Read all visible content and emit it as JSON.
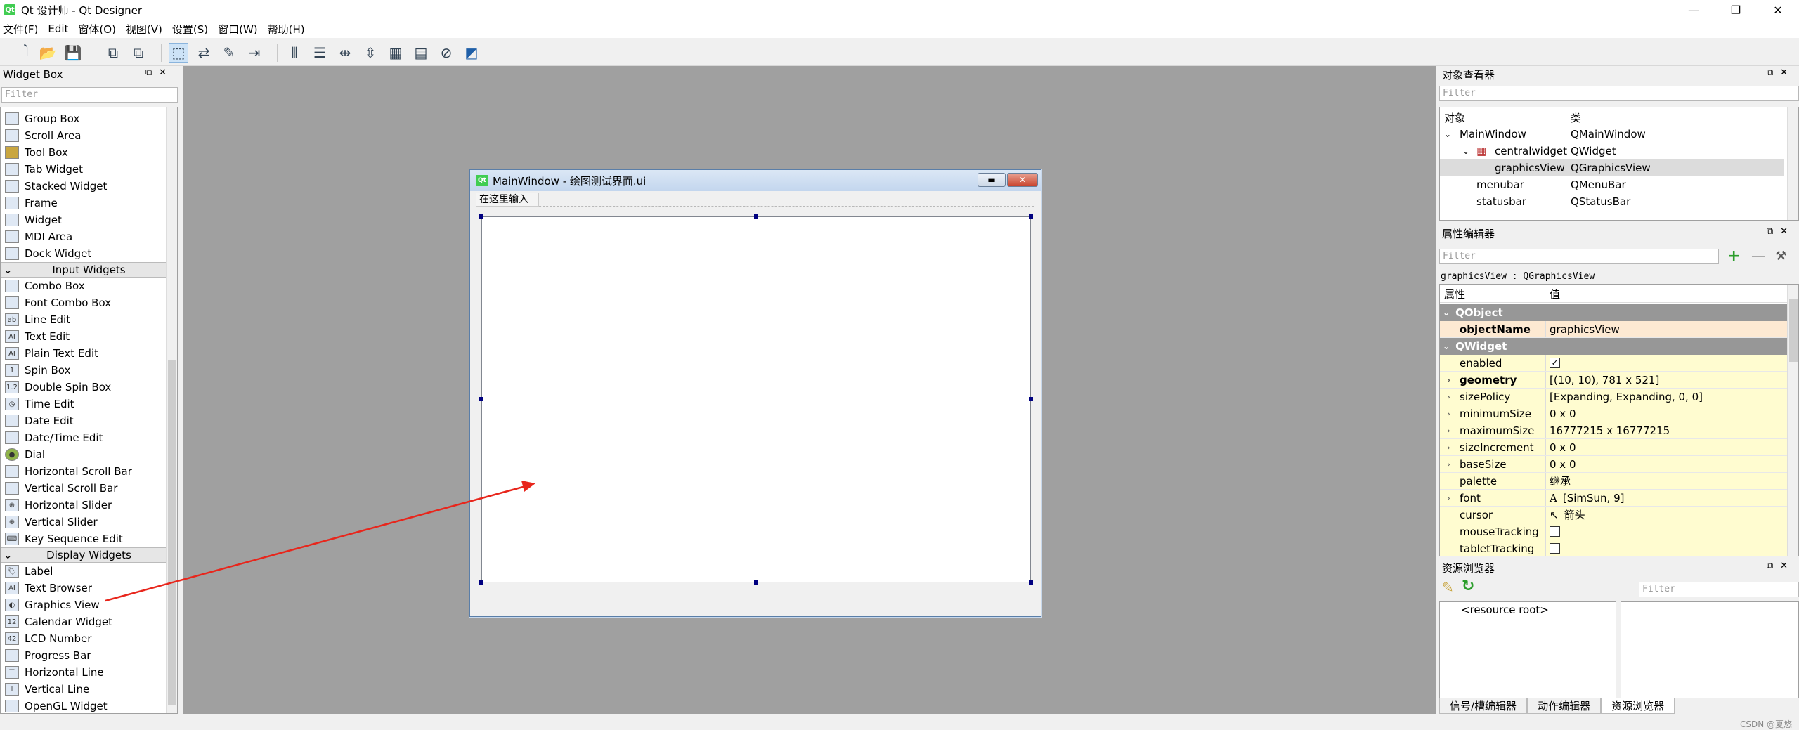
{
  "window": {
    "title": "Qt 设计师 - Qt Designer",
    "app_icon": "Qt"
  },
  "menu": [
    "文件(F)",
    "Edit",
    "窗体(O)",
    "视图(V)",
    "设置(S)",
    "窗口(W)",
    "帮助(H)"
  ],
  "widget_box": {
    "title": "Widget Box",
    "filter_placeholder": "Filter",
    "items_containers": [
      "Group Box",
      "Scroll Area",
      "Tool Box",
      "Tab Widget",
      "Stacked Widget",
      "Frame",
      "Widget",
      "MDI Area",
      "Dock Widget"
    ],
    "cat_input": "Input Widgets",
    "items_input": [
      "Combo Box",
      "Font Combo Box",
      "Line Edit",
      "Text Edit",
      "Plain Text Edit",
      "Spin Box",
      "Double Spin Box",
      "Time Edit",
      "Date Edit",
      "Date/Time Edit",
      "Dial",
      "Horizontal Scroll Bar",
      "Vertical Scroll Bar",
      "Horizontal Slider",
      "Vertical Slider",
      "Key Sequence Edit"
    ],
    "cat_display": "Display Widgets",
    "items_display": [
      "Label",
      "Text Browser",
      "Graphics View",
      "Calendar Widget",
      "LCD Number",
      "Progress Bar",
      "Horizontal Line",
      "Vertical Line",
      "OpenGL Widget"
    ]
  },
  "form": {
    "title": "MainWindow - 绘图测试界面.ui",
    "menu_placeholder": "在这里输入"
  },
  "object_inspector": {
    "title": "对象查看器",
    "filter_placeholder": "Filter",
    "col_object": "对象",
    "col_class": "类",
    "rows": [
      {
        "object": "MainWindow",
        "class": "QMainWindow"
      },
      {
        "object": "centralwidget",
        "class": "QWidget"
      },
      {
        "object": "graphicsView",
        "class": "QGraphicsView"
      },
      {
        "object": "menubar",
        "class": "QMenuBar"
      },
      {
        "object": "statusbar",
        "class": "QStatusBar"
      }
    ]
  },
  "property_editor": {
    "title": "属性编辑器",
    "filter_placeholder": "Filter",
    "context": "graphicsView : QGraphicsView",
    "col_prop": "属性",
    "col_value": "值",
    "cat_qobject": "QObject",
    "cat_qwidget": "QWidget",
    "props": [
      {
        "name": "objectName",
        "value": "graphicsView"
      },
      {
        "name": "enabled",
        "value": "✓"
      },
      {
        "name": "geometry",
        "value": "[(10, 10), 781 x 521]"
      },
      {
        "name": "sizePolicy",
        "value": "[Expanding, Expanding, 0, 0]"
      },
      {
        "name": "minimumSize",
        "value": "0 x 0"
      },
      {
        "name": "maximumSize",
        "value": "16777215 x 16777215"
      },
      {
        "name": "sizeIncrement",
        "value": "0 x 0"
      },
      {
        "name": "baseSize",
        "value": "0 x 0"
      },
      {
        "name": "palette",
        "value": "继承"
      },
      {
        "name": "font",
        "value": "[SimSun, 9]"
      },
      {
        "name": "cursor",
        "value": "箭头"
      },
      {
        "name": "mouseTracking",
        "value": ""
      },
      {
        "name": "tabletTracking",
        "value": ""
      }
    ]
  },
  "resource_browser": {
    "title": "资源浏览器",
    "filter_placeholder": "Filter",
    "root": "<resource root>"
  },
  "bottom_tabs": [
    "信号/槽编辑器",
    "动作编辑器",
    "资源浏览器"
  ],
  "watermark": "CSDN @夏悠"
}
